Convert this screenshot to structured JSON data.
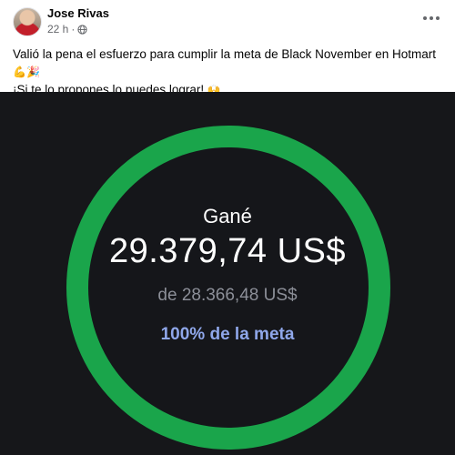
{
  "post": {
    "author": "Jose Rivas",
    "time": "22 h",
    "separator": "·",
    "privacy_icon": "globe-icon",
    "more_icon": "more-options-icon",
    "text_line1": "Valió la pena el esfuerzo para cumplir la meta de Black November en Hotmart",
    "text_line1_emoji": "💪🎉",
    "text_line2": "¡Si te lo propones lo puedes lograr!",
    "text_line2_emoji": "🙌"
  },
  "media": {
    "earned_label": "Gané",
    "earned_amount": "29.379,74 US$",
    "goal_amount": "de 28.366,48 US$",
    "goal_percent_text": "100% de la meta",
    "goal_progress": 1.0,
    "colors": {
      "ring": "#1aa54b",
      "background": "#16171a",
      "percent_text": "#8fa7ea"
    }
  }
}
